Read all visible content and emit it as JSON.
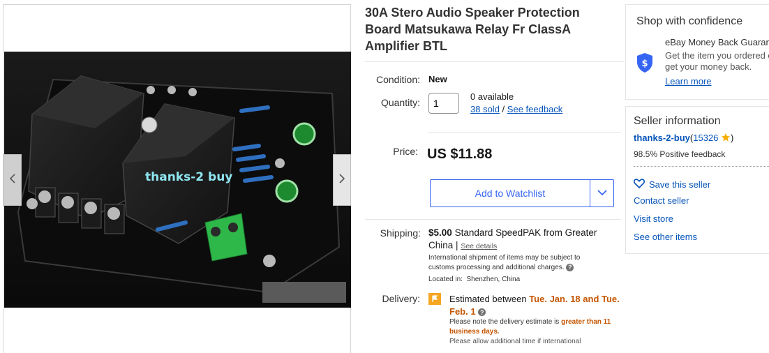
{
  "product": {
    "title": "30A Stero Audio Speaker Protection Board Matsukawa Relay Fr ClassA Amplifier BTL",
    "image_watermark": "thanks-2 buy"
  },
  "condition": {
    "label": "Condition:",
    "value": "New"
  },
  "quantity": {
    "label": "Quantity:",
    "value": "1",
    "available": "0 available",
    "sold_link": "38 sold",
    "separator": "/",
    "feedback_link": "See feedback"
  },
  "price": {
    "label": "Price:",
    "value": "US $11.88"
  },
  "watchlist": {
    "label": "Add to Watchlist"
  },
  "shipping": {
    "label": "Shipping:",
    "cost": "$5.00",
    "method": "Standard SpeedPAK from Greater China",
    "pipe": "|",
    "details_link": "See details",
    "note": "International shipment of items may be subject to customs processing and additional charges.",
    "location_label": "Located in:",
    "location": "Shenzhen, China"
  },
  "delivery": {
    "label": "Delivery:",
    "prefix": "Estimated between",
    "date_range": "Tue. Jan. 18 and Tue. Feb. 1",
    "note_prefix": "Please note the delivery estimate is",
    "note_highlight": "greater than 11 business days.",
    "note2": "Please allow additional time if international"
  },
  "confidence": {
    "title": "Shop with confidence",
    "guarantee_title": "eBay Money Back Guarantee",
    "guarantee_text": "Get the item you ordered or get your money back.",
    "learn_more": "Learn more"
  },
  "seller": {
    "title": "Seller information",
    "name": "thanks-2-buy",
    "score_open": "(",
    "score": "15326",
    "score_close": ")",
    "feedback": "98.5% Positive feedback",
    "save_seller": "Save this seller",
    "contact": "Contact seller",
    "visit_store": "Visit store",
    "other_items": "See other items"
  },
  "colors": {
    "link": "#0654ba",
    "accent_blue": "#3665f3",
    "delivery_orange": "#c45500",
    "star_yellow": "#f5af02"
  },
  "icons": [
    "chevron-left-icon",
    "chevron-right-icon",
    "chevron-down-icon",
    "shield-dollar-icon",
    "heart-icon",
    "star-icon",
    "flag-icon",
    "question-icon"
  ]
}
